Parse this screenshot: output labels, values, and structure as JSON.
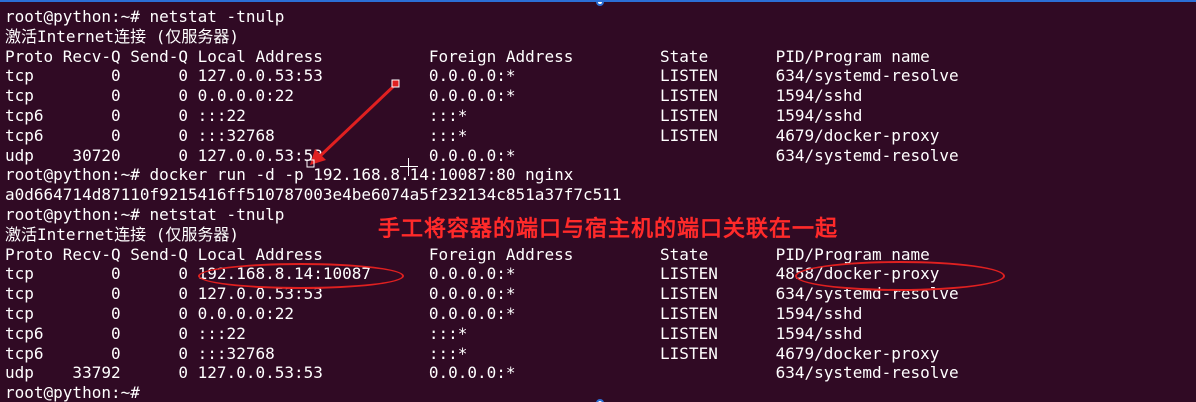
{
  "terminal": {
    "background": "#300a24",
    "text_color": "#ffffff",
    "lines": [
      "root@python:~# netstat -tnulp",
      "激活Internet连接 (仅服务器)",
      "Proto Recv-Q Send-Q Local Address           Foreign Address         State       PID/Program name",
      "tcp        0      0 127.0.0.53:53           0.0.0.0:*               LISTEN      634/systemd-resolve",
      "tcp        0      0 0.0.0.0:22              0.0.0.0:*               LISTEN      1594/sshd",
      "tcp6       0      0 :::22                   :::*                    LISTEN      1594/sshd",
      "tcp6       0      0 :::32768                :::*                    LISTEN      4679/docker-proxy",
      "udp    30720      0 127.0.0.53:53           0.0.0.0:*                           634/systemd-resolve",
      "root@python:~# docker run -d -p 192.168.8.14:10087:80 nginx",
      "a0d664714d87110f9215416ff510787003e4be6074a5f232134c851a37f7c511",
      "root@python:~# netstat -tnulp",
      "激活Internet连接 (仅服务器)",
      "Proto Recv-Q Send-Q Local Address           Foreign Address         State       PID/Program name",
      "tcp        0      0 192.168.8.14:10087      0.0.0.0:*               LISTEN      4858/docker-proxy",
      "tcp        0      0 127.0.0.53:53           0.0.0.0:*               LISTEN      634/systemd-resolve",
      "tcp        0      0 0.0.0.0:22              0.0.0.0:*               LISTEN      1594/sshd",
      "tcp6       0      0 :::22                   :::*                    LISTEN      1594/sshd",
      "tcp6       0      0 :::32768                :::*                    LISTEN      4679/docker-proxy",
      "udp    33792      0 127.0.0.53:53           0.0.0.0:*                           634/systemd-resolve",
      "root@python:~#"
    ]
  },
  "annotation": {
    "text": "手工将容器的端口与宿主机的端口关联在一起",
    "color": "#ff2a2a"
  },
  "markup_color": "#e02020",
  "selection_handle_color": "#2b6fd6"
}
